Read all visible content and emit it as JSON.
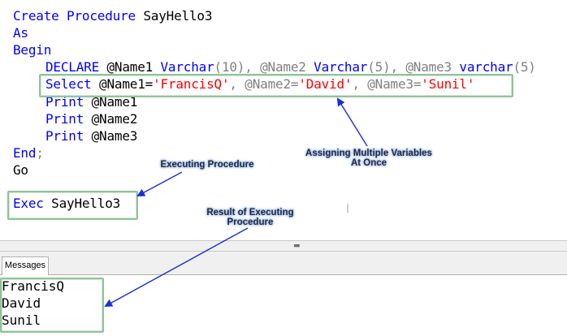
{
  "editor": {
    "line1": {
      "kw": "Create Procedure",
      "name": " SayHello3"
    },
    "line2": {
      "kw": "As"
    },
    "line3": {
      "kw": "Begin"
    },
    "declare": {
      "kw1": "DECLARE",
      "p1": " @Name1 ",
      "t1": "Varchar",
      "p2": "(10), @Name2 ",
      "t2": "Varchar",
      "p3": "(5), @Name3 ",
      "t3": "varchar",
      "p4": "(5)"
    },
    "select": {
      "kw": "Select",
      "a1": " @Name1=",
      "s1": "'FrancisQ'",
      "a2": ", @Name2=",
      "s2": "'David'",
      "a3": ", @Name3=",
      "s3": "'Sunil'"
    },
    "prints": [
      {
        "kw": "Print",
        "var": " @Name1"
      },
      {
        "kw": "Print",
        "var": " @Name2"
      },
      {
        "kw": "Print",
        "var": " @Name3"
      }
    ],
    "end": {
      "kw": "End",
      "semi": ";"
    },
    "go": "Go",
    "exec": {
      "kw": "Exec",
      "name": " SayHello3"
    }
  },
  "annotations": {
    "assign_line1": "Assigning Multiple Variables",
    "assign_line2": "At Once",
    "executing": "Executing Procedure",
    "result_line1": "Result of Executing",
    "result_line2": "Procedure"
  },
  "results": {
    "tab_label": "Messages",
    "output": [
      "FrancisQ",
      "David",
      "Sunil"
    ]
  },
  "colors": {
    "keyword": "#0000ff",
    "string": "#ff0000",
    "highlight_box": "#8fc39a",
    "arrow": "#1a2fd6"
  },
  "icons": {
    "splitter_grip": "grip-icon",
    "text_cursor": "ibeam-cursor-icon"
  }
}
